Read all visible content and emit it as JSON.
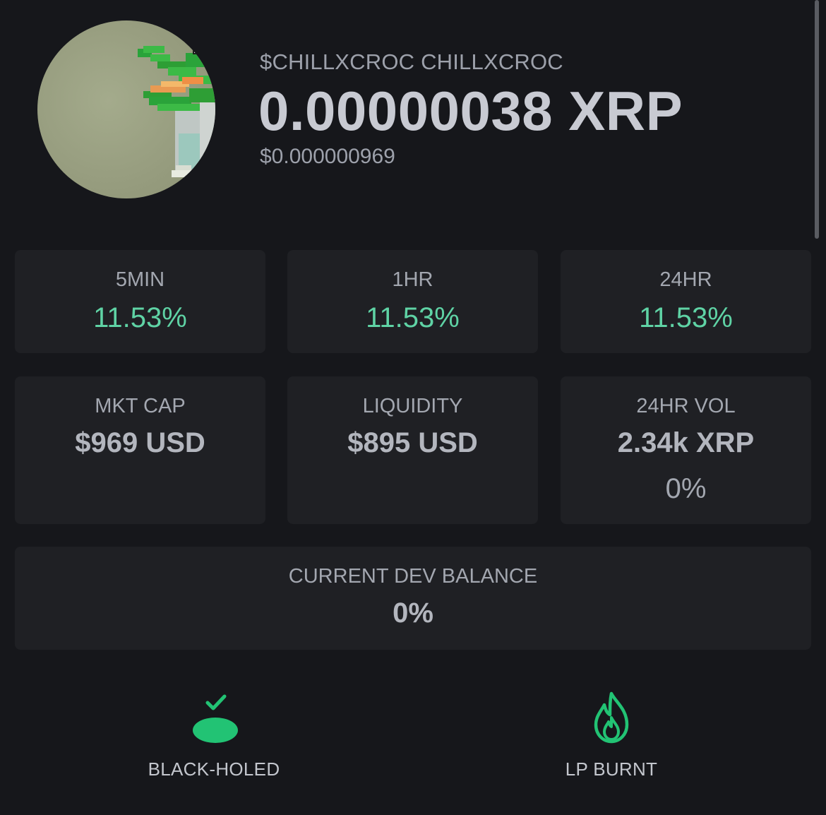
{
  "token": {
    "name": "$CHILLXCROC CHILLXCROC",
    "price_xrp": "0.00000038 XRP",
    "price_usd": "$0.000000969",
    "avatar_icon": "pixel-crocodile-avatar"
  },
  "changes": [
    {
      "label": "5MIN",
      "value": "11.53%"
    },
    {
      "label": "1HR",
      "value": "11.53%"
    },
    {
      "label": "24HR",
      "value": "11.53%"
    }
  ],
  "stats": {
    "mkt_cap": {
      "label": "MKT CAP",
      "value": "$969 USD"
    },
    "liquidity": {
      "label": "LIQUIDITY",
      "value": "$895 USD"
    },
    "volume": {
      "label": "24HR VOL",
      "value": "2.34k XRP",
      "change": "0%"
    }
  },
  "dev_balance": {
    "label": "CURRENT DEV BALANCE",
    "value": "0%"
  },
  "badges": {
    "black_holed": {
      "label": "BLACK-HOLED",
      "icon": "black-hole-check-icon"
    },
    "lp_burnt": {
      "label": "LP BURNT",
      "icon": "flame-icon"
    }
  },
  "colors": {
    "background": "#16171b",
    "card": "#1f2024",
    "positive": "#5fd3a5",
    "accent_green": "#22c374"
  }
}
